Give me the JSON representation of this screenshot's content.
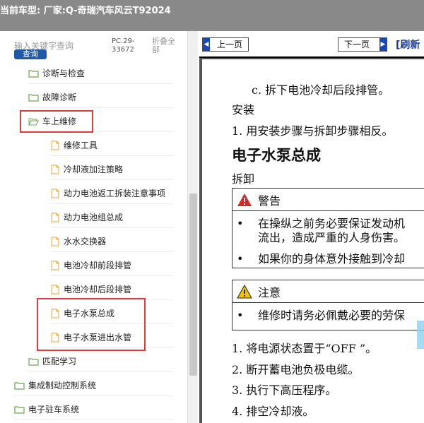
{
  "window": {
    "title": "当前车型:  厂家:Q-奇瑞汽车风云T92024"
  },
  "search": {
    "placeholder": "输入关键字查询",
    "button": "查询",
    "pc_code": "PC.29-33672",
    "collapse": "折叠全部"
  },
  "tree": {
    "items": [
      {
        "label": "诊断与检查",
        "type": "folder"
      },
      {
        "label": "故障诊断",
        "type": "folder"
      },
      {
        "label": "车上维修",
        "type": "folder-open"
      },
      {
        "label": "维修工具",
        "type": "file"
      },
      {
        "label": "冷却液加注策略",
        "type": "file"
      },
      {
        "label": "动力电池返工拆装注意事项",
        "type": "file"
      },
      {
        "label": "动力电池组总成",
        "type": "file"
      },
      {
        "label": "水水交换器",
        "type": "file"
      },
      {
        "label": "电池冷却前段排管",
        "type": "file"
      },
      {
        "label": "电池冷却后段排管",
        "type": "file"
      },
      {
        "label": "电子水泵总成",
        "type": "file"
      },
      {
        "label": "电子水泵进出水管",
        "type": "file"
      },
      {
        "label": "匹配学习",
        "type": "folder"
      },
      {
        "label": "集成制动控制系统",
        "type": "folder"
      },
      {
        "label": "电子驻车系统",
        "type": "folder"
      }
    ]
  },
  "nav": {
    "prev": "上一页",
    "next": "下一页",
    "refresh": "[刷新"
  },
  "doc": {
    "l1": "c. 拆下电池冷却后段排管。",
    "l2": "安装",
    "l3": "1. 用安装步骤与拆卸步骤相反。",
    "title": "电子水泵总成",
    "l5": "拆卸",
    "warning": {
      "header": "警告",
      "b1a": "在操纵之前务必要保证发动机",
      "b1b": "流出，造成严重的人身伤害。",
      "b2": "如果你的身体意外接触到冷却"
    },
    "caution": {
      "header": "注意",
      "b1": "维修时请务必佩戴必要的劳保"
    },
    "steps": [
      "1. 将电源状态置于“OFF ”。",
      "2. 断开蓄电池负极电缆。",
      "3. 执行下高压程序。",
      "4. 排空冷却液。"
    ]
  },
  "colors": {
    "highlight": "#e03c3c",
    "folder": "#6aa84f",
    "file": "#f0a030",
    "titlebar": "#898989",
    "viewer_bg": "#555555"
  }
}
